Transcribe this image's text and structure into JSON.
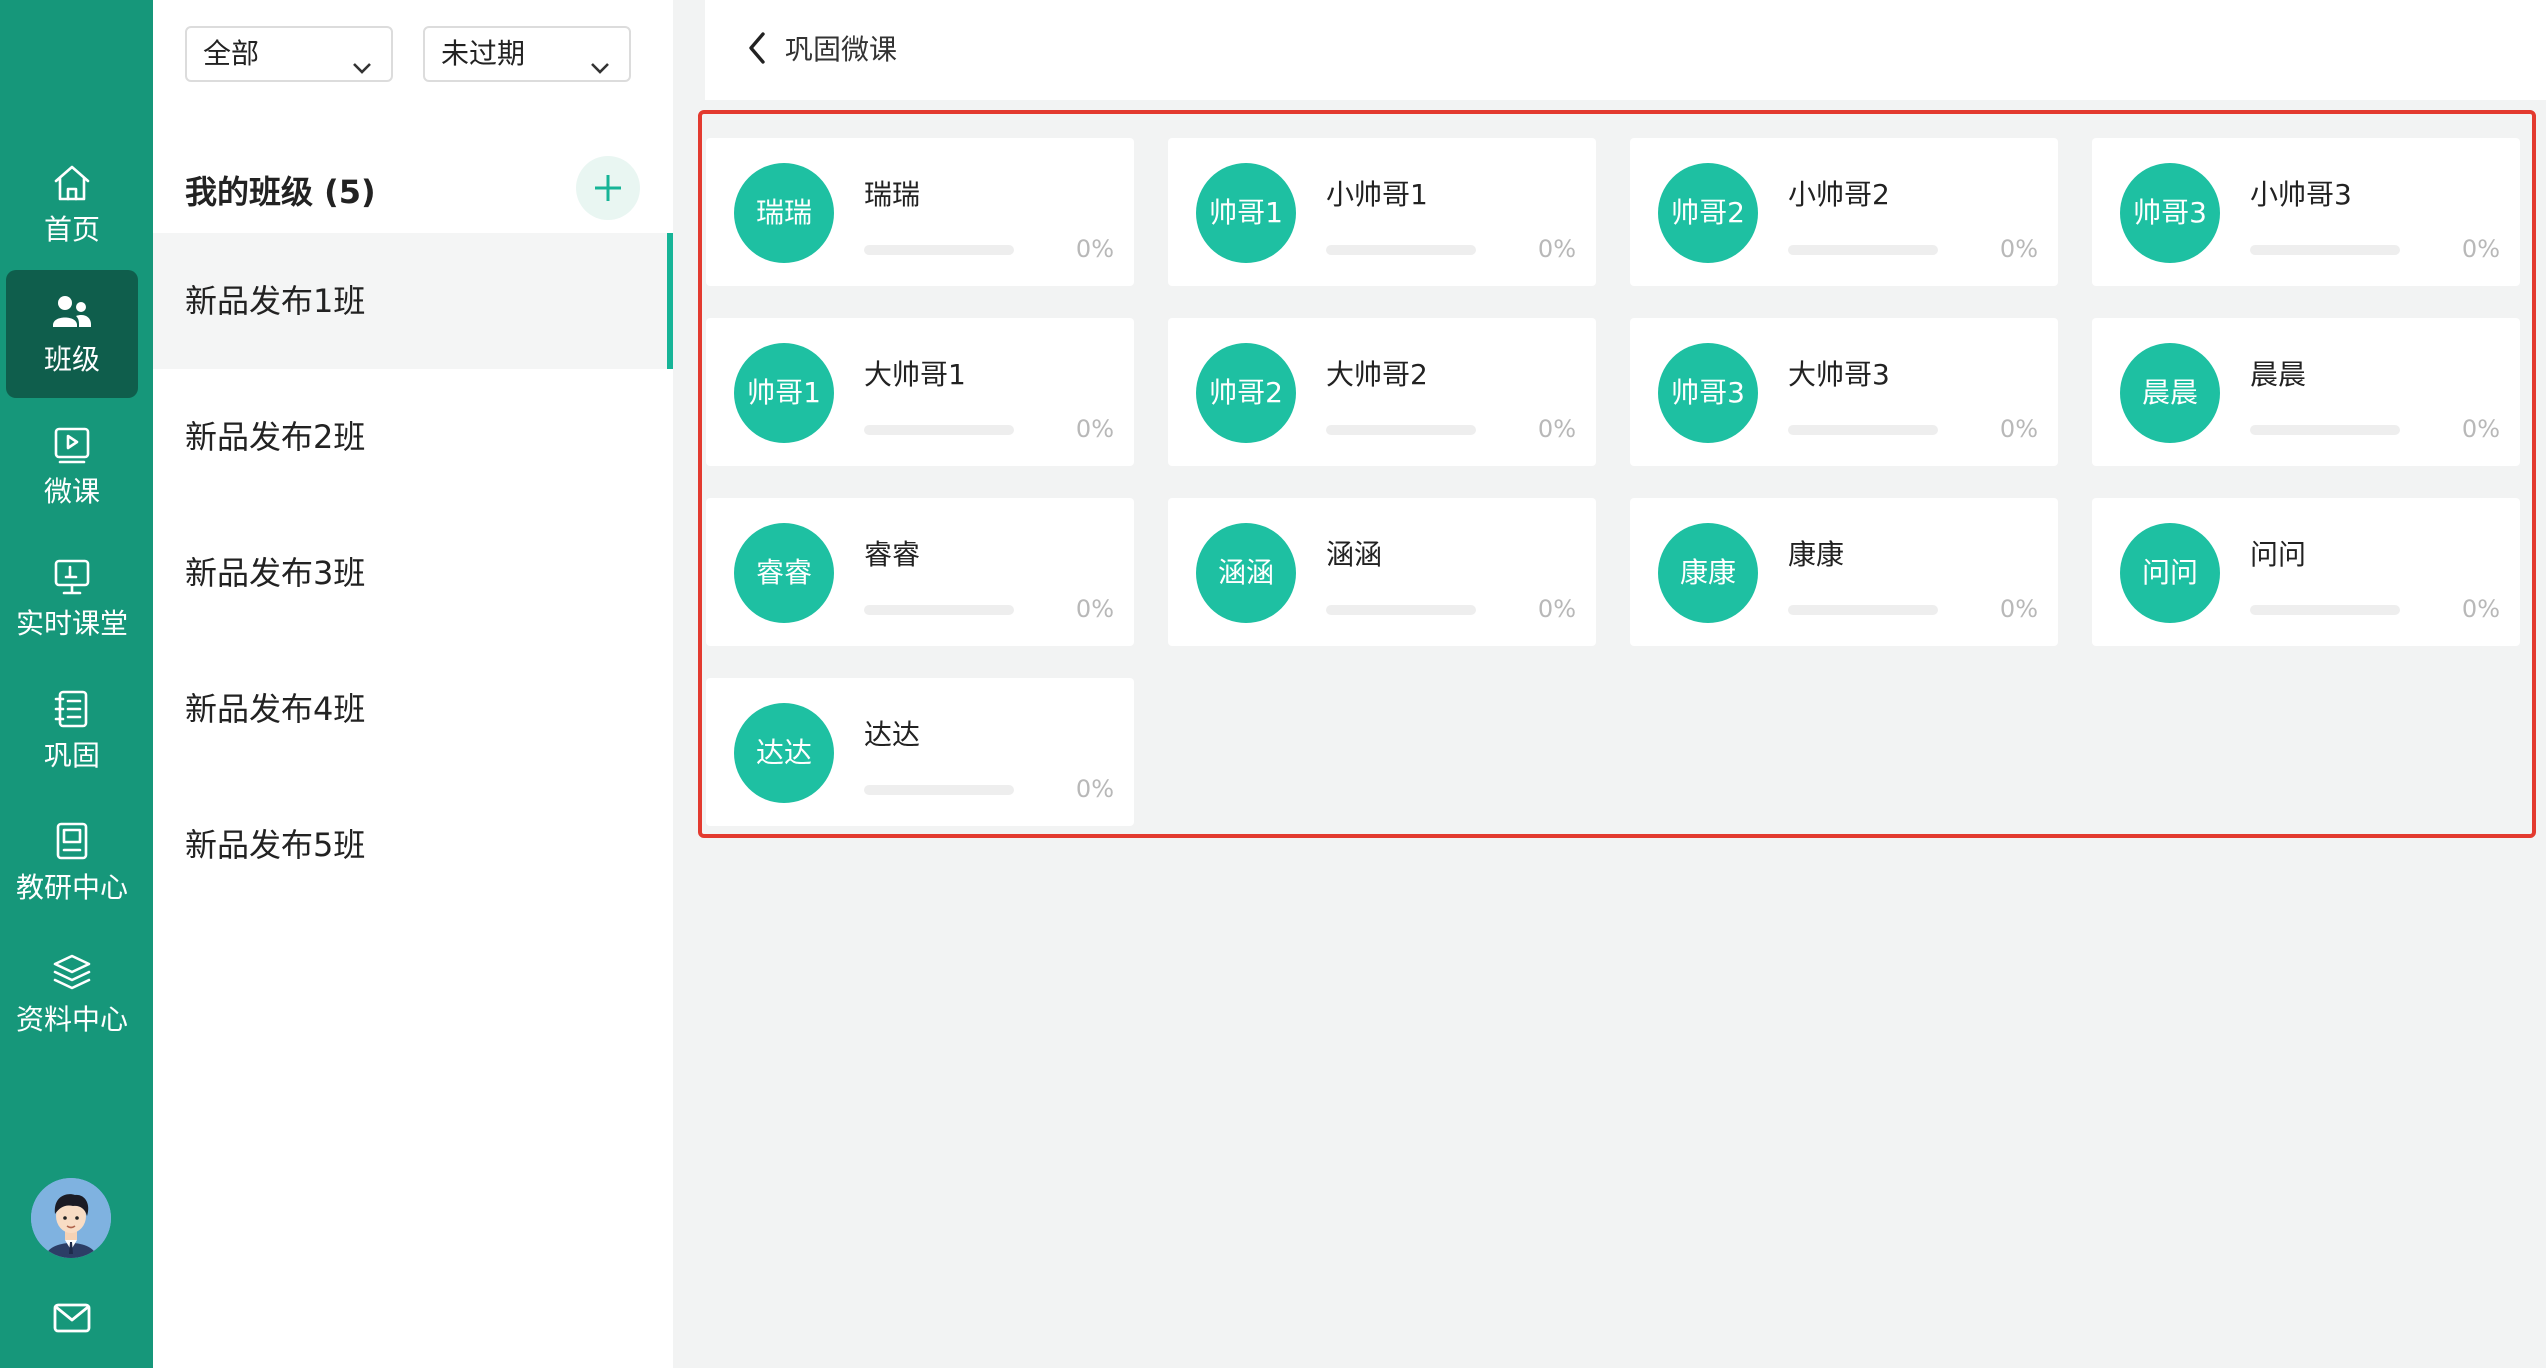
{
  "nav": {
    "items": [
      {
        "label": "首页",
        "icon": "home-icon",
        "active": false
      },
      {
        "label": "班级",
        "icon": "users-icon",
        "active": true
      },
      {
        "label": "微课",
        "icon": "video-icon",
        "active": false
      },
      {
        "label": "实时课堂",
        "icon": "whiteboard-icon",
        "active": false
      },
      {
        "label": "巩固",
        "icon": "notebook-icon",
        "active": false
      },
      {
        "label": "教研中心",
        "icon": "book-icon",
        "active": false
      },
      {
        "label": "资料中心",
        "icon": "layers-icon",
        "active": false
      }
    ]
  },
  "filters": {
    "scope": "全部",
    "status": "未过期"
  },
  "classes": {
    "title": "我的班级 (5)",
    "items": [
      "新品发布1班",
      "新品发布2班",
      "新品发布3班",
      "新品发布4班",
      "新品发布5班"
    ],
    "active_index": 0
  },
  "header": {
    "title": "巩固微课"
  },
  "students": [
    {
      "avatar": "瑞瑞",
      "name": "瑞瑞",
      "progress": 0,
      "progress_label": "0%"
    },
    {
      "avatar": "帅哥1",
      "name": "小帅哥1",
      "progress": 0,
      "progress_label": "0%"
    },
    {
      "avatar": "帅哥2",
      "name": "小帅哥2",
      "progress": 0,
      "progress_label": "0%"
    },
    {
      "avatar": "帅哥3",
      "name": "小帅哥3",
      "progress": 0,
      "progress_label": "0%"
    },
    {
      "avatar": "帅哥1",
      "name": "大帅哥1",
      "progress": 0,
      "progress_label": "0%"
    },
    {
      "avatar": "帅哥2",
      "name": "大帅哥2",
      "progress": 0,
      "progress_label": "0%"
    },
    {
      "avatar": "帅哥3",
      "name": "大帅哥3",
      "progress": 0,
      "progress_label": "0%"
    },
    {
      "avatar": "晨晨",
      "name": "晨晨",
      "progress": 0,
      "progress_label": "0%"
    },
    {
      "avatar": "睿睿",
      "name": "睿睿",
      "progress": 0,
      "progress_label": "0%"
    },
    {
      "avatar": "涵涵",
      "name": "涵涵",
      "progress": 0,
      "progress_label": "0%"
    },
    {
      "avatar": "康康",
      "name": "康康",
      "progress": 0,
      "progress_label": "0%"
    },
    {
      "avatar": "问问",
      "name": "问问",
      "progress": 0,
      "progress_label": "0%"
    },
    {
      "avatar": "达达",
      "name": "达达",
      "progress": 0,
      "progress_label": "0%"
    }
  ],
  "colors": {
    "rail": "#16977a",
    "rail_active": "#0f5e4c",
    "accent": "#1ec0a2",
    "highlight_border": "#e33a2f"
  }
}
